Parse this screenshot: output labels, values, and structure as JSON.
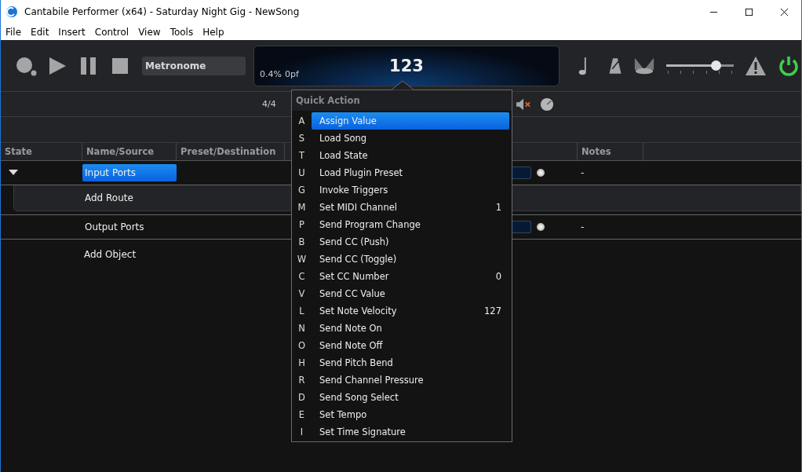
{
  "window": {
    "title": "Cantabile Performer (x64) - Saturday Night Gig - NewSong"
  },
  "menu": [
    "File",
    "Edit",
    "Insert",
    "Control",
    "View",
    "Tools",
    "Help"
  ],
  "toolbar": {
    "metronome": "Metronome",
    "load": "0.4%",
    "time": "0pf",
    "tempo": "123",
    "volume": {
      "level": 0.74
    },
    "power_on": true
  },
  "subbar": {
    "time_signature": "4/4",
    "muted": true
  },
  "table": {
    "columns": [
      "State",
      "Name/Source",
      "Preset/Destination",
      "Notes"
    ],
    "rows": [
      {
        "kind": "group",
        "expanded": true,
        "name": "Input Ports",
        "selected": true,
        "notes": "-"
      },
      {
        "kind": "add",
        "name": "Add Route"
      },
      {
        "kind": "group",
        "name": "Output Ports",
        "selected": false,
        "notes": "-"
      },
      {
        "kind": "add",
        "name": "Add Object"
      }
    ]
  },
  "quick_action": {
    "title": "Quick Action",
    "items": [
      {
        "key": "A",
        "label": "Assign Value",
        "selected": true
      },
      {
        "key": "S",
        "label": "Load Song",
        "selected": false
      },
      {
        "key": "T",
        "label": "Load State",
        "selected": false
      },
      {
        "key": "U",
        "label": "Load Plugin Preset",
        "selected": false
      },
      {
        "key": "G",
        "label": "Invoke Triggers",
        "selected": false
      },
      {
        "key": "M",
        "label": "Set MIDI Channel",
        "value": "1",
        "selected": false
      },
      {
        "key": "P",
        "label": "Send Program Change",
        "selected": false
      },
      {
        "key": "B",
        "label": "Send CC (Push)",
        "selected": false
      },
      {
        "key": "W",
        "label": "Send CC (Toggle)",
        "selected": false
      },
      {
        "key": "C",
        "label": "Set CC Number",
        "value": "0",
        "selected": false
      },
      {
        "key": "V",
        "label": "Send CC Value",
        "selected": false
      },
      {
        "key": "L",
        "label": "Set Note Velocity",
        "value": "127",
        "selected": false
      },
      {
        "key": "N",
        "label": "Send Note On",
        "selected": false
      },
      {
        "key": "O",
        "label": "Send Note Off",
        "selected": false
      },
      {
        "key": "H",
        "label": "Send Pitch Bend",
        "selected": false
      },
      {
        "key": "R",
        "label": "Send Channel Pressure",
        "selected": false
      },
      {
        "key": "D",
        "label": "Send Song Select",
        "selected": false
      },
      {
        "key": "E",
        "label": "Set Tempo",
        "selected": false
      },
      {
        "key": "I",
        "label": "Set Time Signature",
        "selected": false
      }
    ]
  }
}
